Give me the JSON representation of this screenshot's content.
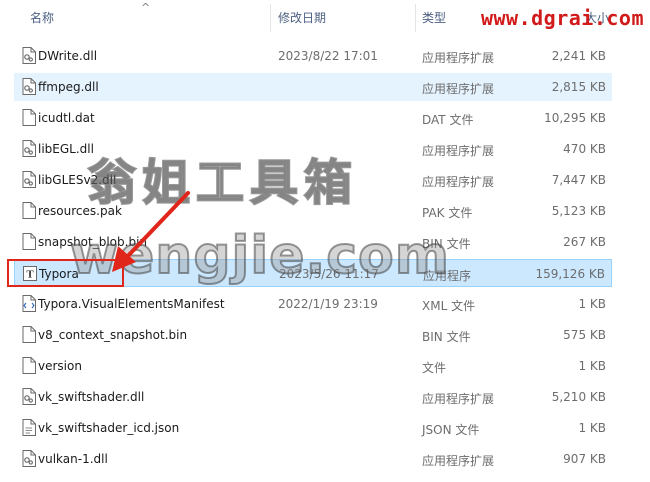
{
  "header": {
    "name": "名称",
    "date": "修改日期",
    "type": "类型",
    "size": "大小"
  },
  "site_watermark": "www.dgrai.com",
  "overlay_watermark_cn": "翁姐工具箱",
  "overlay_watermark_en": "wengjie.com",
  "files": [
    {
      "name": "DWrite.dll",
      "date": "2023/8/22 17:01",
      "type": "应用程序扩展",
      "size": "2,241 KB",
      "icon": "dll-icon",
      "state": "normal"
    },
    {
      "name": "ffmpeg.dll",
      "date": "",
      "type": "应用程序扩展",
      "size": "2,815 KB",
      "icon": "dll-icon",
      "state": "hover"
    },
    {
      "name": "icudtl.dat",
      "date": "",
      "type": "DAT 文件",
      "size": "10,295 KB",
      "icon": "file-icon",
      "state": "normal"
    },
    {
      "name": "libEGL.dll",
      "date": "",
      "type": "应用程序扩展",
      "size": "470 KB",
      "icon": "dll-icon",
      "state": "normal"
    },
    {
      "name": "libGLESv2.dll",
      "date": "",
      "type": "应用程序扩展",
      "size": "7,447 KB",
      "icon": "dll-icon",
      "state": "normal"
    },
    {
      "name": "resources.pak",
      "date": "",
      "type": "PAK 文件",
      "size": "5,123 KB",
      "icon": "file-icon",
      "state": "normal"
    },
    {
      "name": "snapshot_blob.bin",
      "date": "",
      "type": "BIN 文件",
      "size": "267 KB",
      "icon": "file-icon",
      "state": "normal"
    },
    {
      "name": "Typora",
      "date": "2023/5/26 11:17",
      "type": "应用程序",
      "size": "159,126 KB",
      "icon": "typora-icon",
      "state": "selected"
    },
    {
      "name": "Typora.VisualElementsManifest",
      "date": "2022/1/19 23:19",
      "type": "XML 文件",
      "size": "1 KB",
      "icon": "xml-icon",
      "state": "normal"
    },
    {
      "name": "v8_context_snapshot.bin",
      "date": "",
      "type": "BIN 文件",
      "size": "575 KB",
      "icon": "file-icon",
      "state": "normal"
    },
    {
      "name": "version",
      "date": "",
      "type": "文件",
      "size": "1 KB",
      "icon": "file-icon",
      "state": "normal"
    },
    {
      "name": "vk_swiftshader.dll",
      "date": "",
      "type": "应用程序扩展",
      "size": "5,210 KB",
      "icon": "dll-icon",
      "state": "normal"
    },
    {
      "name": "vk_swiftshader_icd.json",
      "date": "",
      "type": "JSON 文件",
      "size": "1 KB",
      "icon": "json-icon",
      "state": "normal"
    },
    {
      "name": "vulkan-1.dll",
      "date": "",
      "type": "应用程序扩展",
      "size": "907 KB",
      "icon": "dll-icon",
      "state": "normal"
    }
  ],
  "colors": {
    "selected_bg": "#cce8ff",
    "hover_bg": "#e5f3ff",
    "accent_red": "#e0251a",
    "header_text": "#4d6082"
  }
}
